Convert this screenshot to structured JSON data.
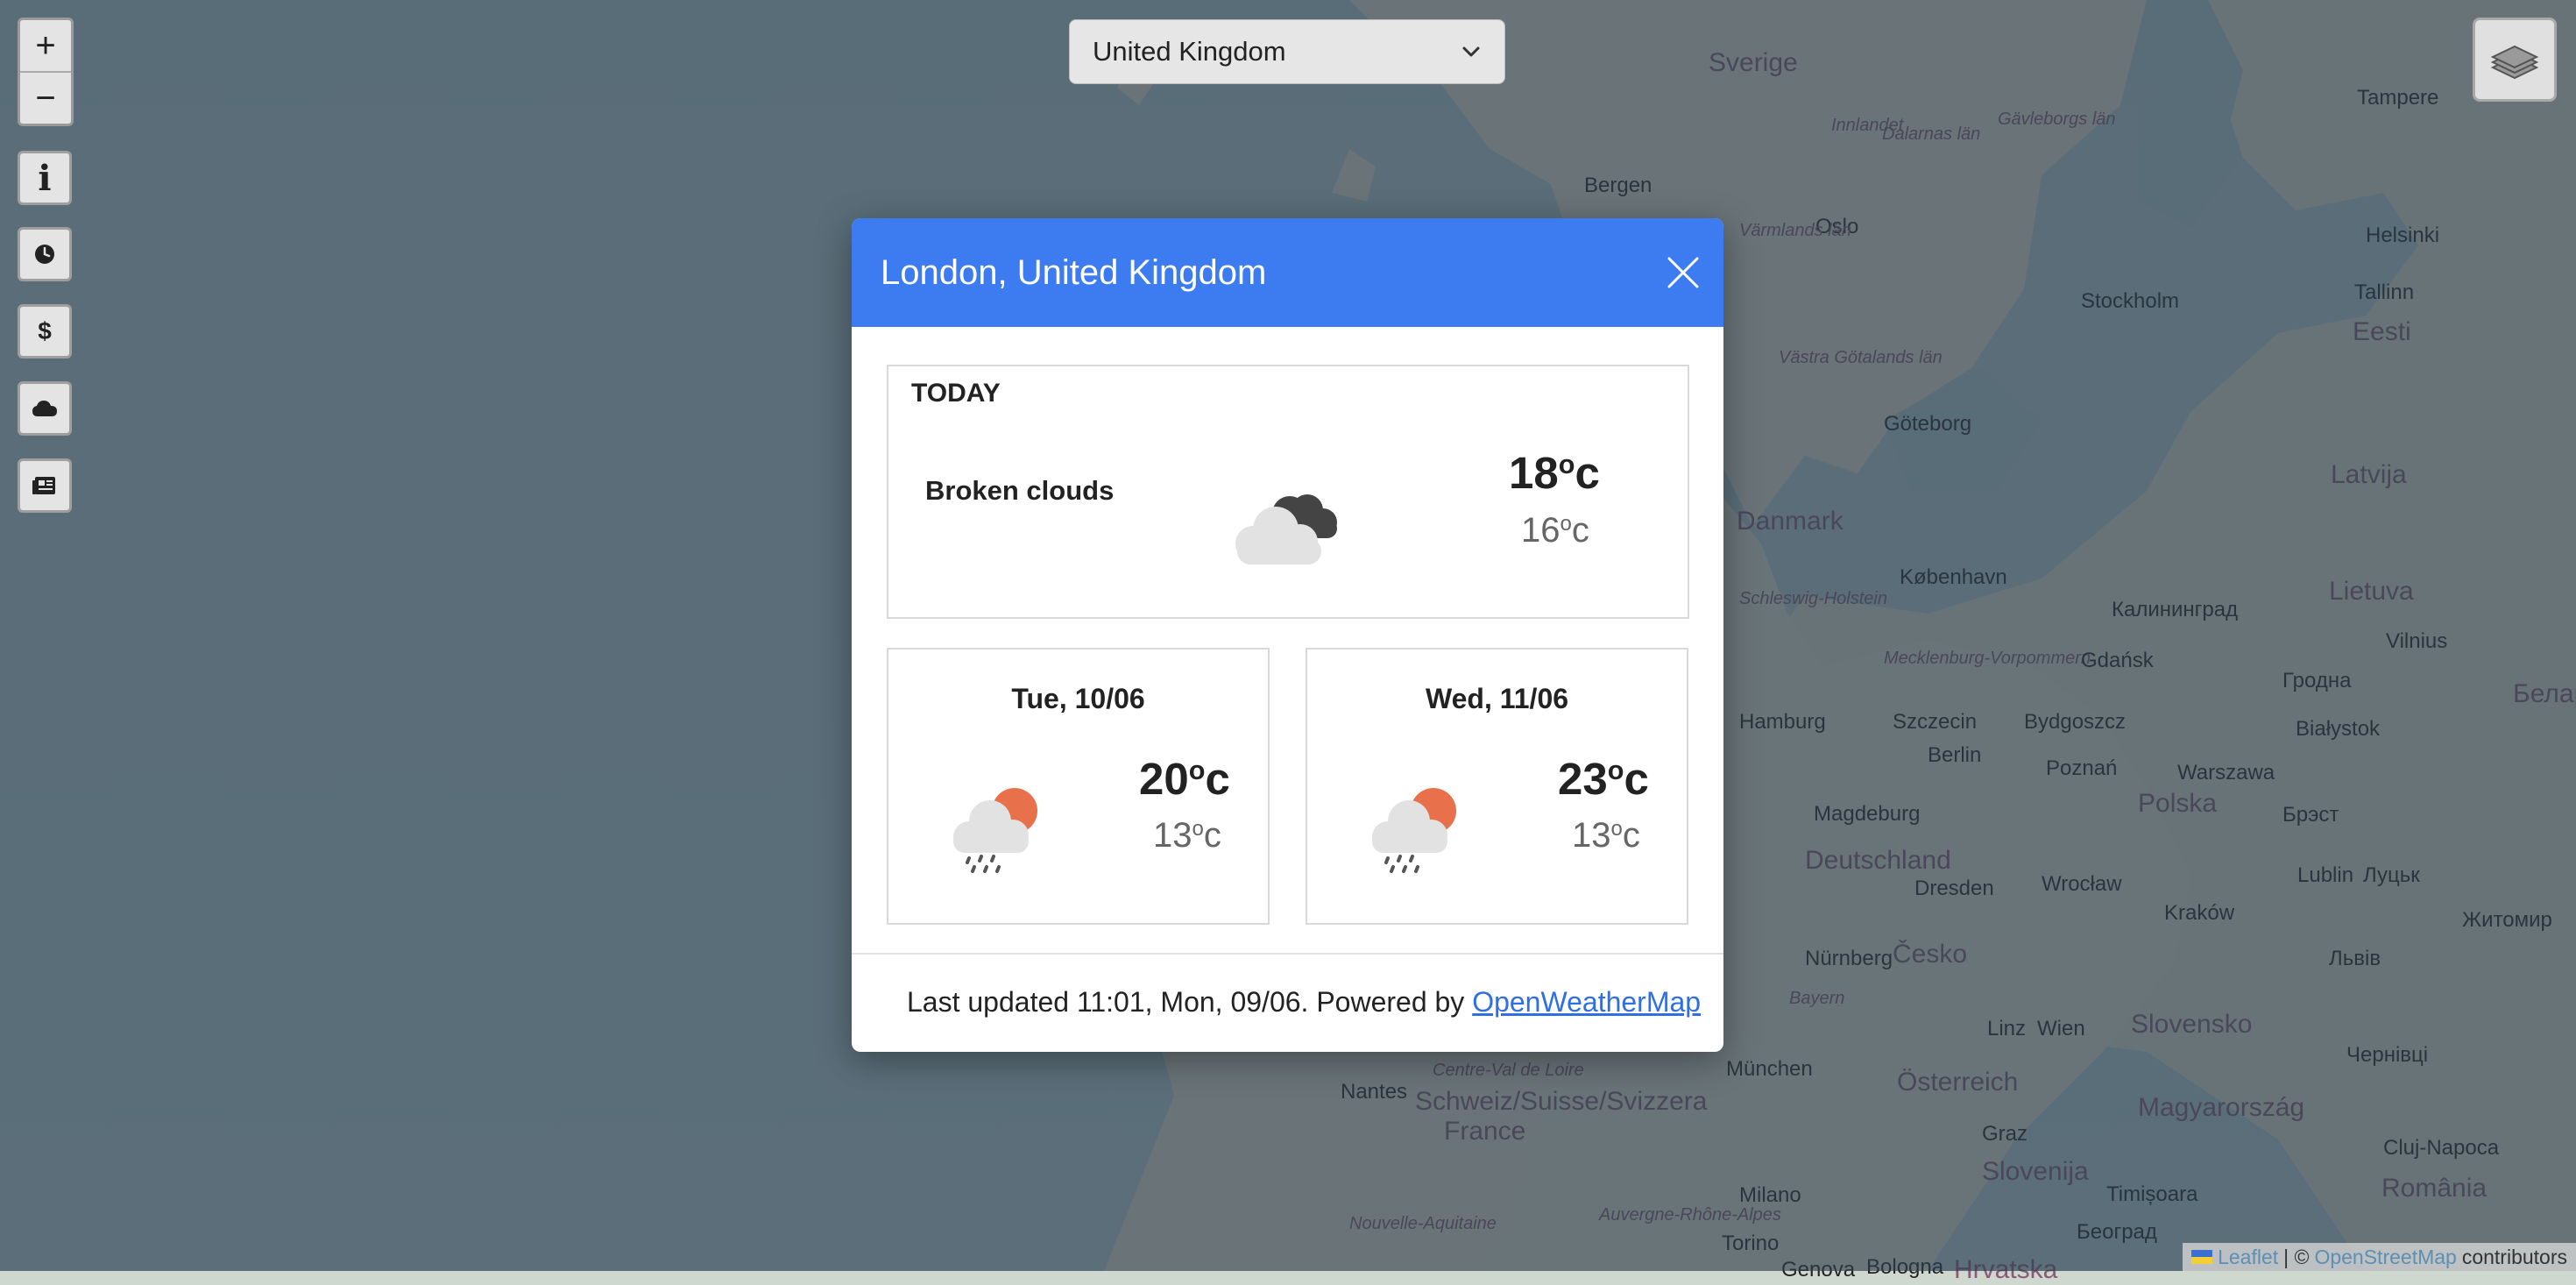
{
  "map": {
    "labels": [
      {
        "text": "Sverige",
        "kind": "country"
      },
      {
        "text": "Bergen",
        "kind": "city"
      },
      {
        "text": "Oslo",
        "kind": "city"
      },
      {
        "text": "Innlandet",
        "kind": "region"
      },
      {
        "text": "Dalarnas län",
        "kind": "region"
      },
      {
        "text": "Gävleborgs län",
        "kind": "region"
      },
      {
        "text": "Tampere",
        "kind": "city"
      },
      {
        "text": "Helsinki",
        "kind": "city"
      },
      {
        "text": "Tallinn",
        "kind": "city"
      },
      {
        "text": "Eesti",
        "kind": "country"
      },
      {
        "text": "Stockholm",
        "kind": "city"
      },
      {
        "text": "Värmlands län",
        "kind": "region"
      },
      {
        "text": "Västra Götalands län",
        "kind": "region"
      },
      {
        "text": "Göteborg",
        "kind": "city"
      },
      {
        "text": "Danmark",
        "kind": "country"
      },
      {
        "text": "København",
        "kind": "city"
      },
      {
        "text": "Latvija",
        "kind": "country"
      },
      {
        "text": "Lietuva",
        "kind": "country"
      },
      {
        "text": "Калининград",
        "kind": "city"
      },
      {
        "text": "Vilnius",
        "kind": "city"
      },
      {
        "text": "Schleswig-Holstein",
        "kind": "region"
      },
      {
        "text": "Mecklenburg-Vorpommern",
        "kind": "region"
      },
      {
        "text": "Gdańsk",
        "kind": "city"
      },
      {
        "text": "Гродна",
        "kind": "city"
      },
      {
        "text": "Беларусь",
        "kind": "country"
      },
      {
        "text": "Hamburg",
        "kind": "city"
      },
      {
        "text": "Szczecin",
        "kind": "city"
      },
      {
        "text": "Bydgoszcz",
        "kind": "city"
      },
      {
        "text": "Białystok",
        "kind": "city"
      },
      {
        "text": "Berlin",
        "kind": "city"
      },
      {
        "text": "Poznań",
        "kind": "city"
      },
      {
        "text": "Warszawa",
        "kind": "city"
      },
      {
        "text": "Polska",
        "kind": "country"
      },
      {
        "text": "Magdeburg",
        "kind": "city"
      },
      {
        "text": "Deutschland",
        "kind": "country"
      },
      {
        "text": "Брэст",
        "kind": "city"
      },
      {
        "text": "Dresden",
        "kind": "city"
      },
      {
        "text": "Wrocław",
        "kind": "city"
      },
      {
        "text": "Lublin",
        "kind": "city"
      },
      {
        "text": "Луцьк",
        "kind": "city"
      },
      {
        "text": "Kraków",
        "kind": "city"
      },
      {
        "text": "Житомир",
        "kind": "city"
      },
      {
        "text": "Nürnberg",
        "kind": "city"
      },
      {
        "text": "Česko",
        "kind": "country"
      },
      {
        "text": "Львів",
        "kind": "city"
      },
      {
        "text": "Bayern",
        "kind": "region"
      },
      {
        "text": "Linz",
        "kind": "city"
      },
      {
        "text": "Wien",
        "kind": "city"
      },
      {
        "text": "Slovensko",
        "kind": "country"
      },
      {
        "text": "München",
        "kind": "city"
      },
      {
        "text": "Österreich",
        "kind": "country"
      },
      {
        "text": "Чернівці",
        "kind": "city"
      },
      {
        "text": "Nantes",
        "kind": "city"
      },
      {
        "text": "Centre-Val de Loire",
        "kind": "region"
      },
      {
        "text": "France",
        "kind": "country"
      },
      {
        "text": "Schweiz/Suisse/Svizzera",
        "kind": "country"
      },
      {
        "text": "Graz",
        "kind": "city"
      },
      {
        "text": "Magyarország",
        "kind": "country"
      },
      {
        "text": "Cluj-Napoca",
        "kind": "city"
      },
      {
        "text": "Slovenija",
        "kind": "country"
      },
      {
        "text": "Milano",
        "kind": "city"
      },
      {
        "text": "Timișoara",
        "kind": "city"
      },
      {
        "text": "România",
        "kind": "country"
      },
      {
        "text": "Nouvelle-Aquitaine",
        "kind": "region"
      },
      {
        "text": "Auvergne-Rhône-Alpes",
        "kind": "region"
      },
      {
        "text": "Torino",
        "kind": "city"
      },
      {
        "text": "Београд",
        "kind": "city"
      },
      {
        "text": "Genova",
        "kind": "city"
      },
      {
        "text": "Bologna",
        "kind": "city"
      },
      {
        "text": "Hrvatska",
        "kind": "country"
      }
    ]
  },
  "controls": {
    "zoom_in": "+",
    "zoom_out": "−",
    "buttons": [
      {
        "icon": "info-icon",
        "glyph": "i"
      },
      {
        "icon": "clock-icon"
      },
      {
        "icon": "dollar-icon",
        "glyph": "$"
      },
      {
        "icon": "cloud-icon"
      },
      {
        "icon": "newspaper-icon"
      }
    ]
  },
  "country_select": {
    "selected": "United Kingdom"
  },
  "attribution": {
    "leaflet": "Leaflet",
    "separator": "| ©",
    "osm": "OpenStreetMap",
    "suffix": "contributors"
  },
  "modal": {
    "title": "London, United Kingdom",
    "today": {
      "heading": "TODAY",
      "description": "Broken clouds",
      "icon": "broken-clouds-icon",
      "high": "18",
      "low": "16",
      "unit": "c",
      "degree": "o"
    },
    "forecast": [
      {
        "day": "Tue, 10/06",
        "icon": "light-rain-sun-icon",
        "high": "20",
        "low": "13",
        "unit": "c",
        "degree": "o"
      },
      {
        "day": "Wed, 11/06",
        "icon": "light-rain-sun-icon",
        "high": "23",
        "low": "13",
        "unit": "c",
        "degree": "o"
      }
    ],
    "footer": {
      "text": "Last updated 11:01, Mon, 09/06. Powered by ",
      "link": "OpenWeatherMap"
    }
  },
  "colors": {
    "header": "#3d7bf0",
    "sun": "#e8704a",
    "overlay": "rgba(44,62,75,0.68)"
  }
}
